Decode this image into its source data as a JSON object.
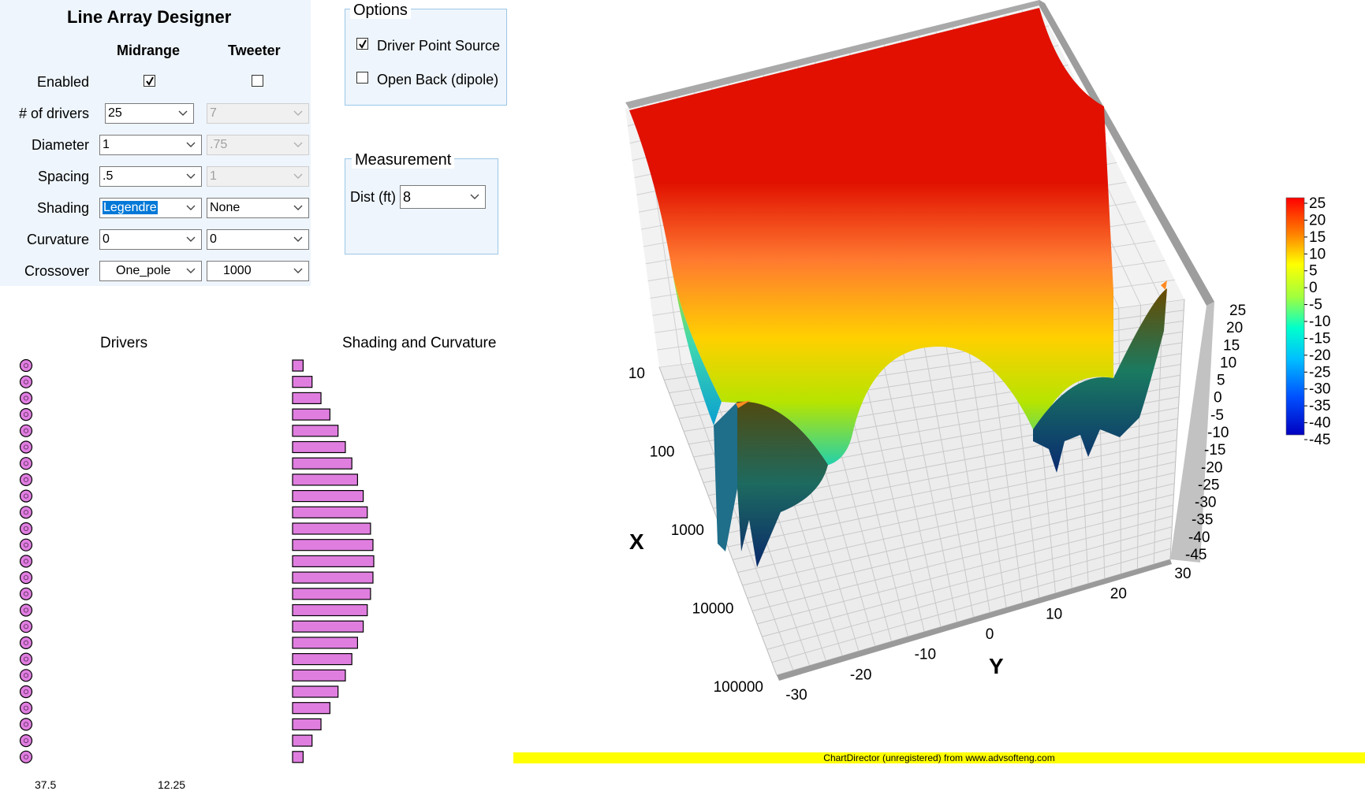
{
  "designer": {
    "title": "Line Array Designer",
    "columns": {
      "midrange": "Midrange",
      "tweeter": "Tweeter"
    },
    "rows": [
      {
        "label": "Enabled",
        "midrange": {
          "type": "checkbox",
          "checked": true
        },
        "tweeter": {
          "type": "checkbox",
          "checked": false
        }
      },
      {
        "label": "# of drivers",
        "midrange": {
          "type": "combo",
          "value": "25",
          "enabled": true
        },
        "tweeter": {
          "type": "combo",
          "value": "7",
          "enabled": false
        }
      },
      {
        "label": "Diameter",
        "midrange": {
          "type": "combo",
          "value": "1",
          "enabled": true
        },
        "tweeter": {
          "type": "combo",
          "value": ".75",
          "enabled": false
        }
      },
      {
        "label": "Spacing",
        "midrange": {
          "type": "combo",
          "value": ".5",
          "enabled": true
        },
        "tweeter": {
          "type": "combo",
          "value": "1",
          "enabled": false
        }
      },
      {
        "label": "Shading",
        "midrange": {
          "type": "combo",
          "value": "Legendre",
          "enabled": true,
          "selected": true
        },
        "tweeter": {
          "type": "combo",
          "value": "None",
          "enabled": true
        }
      },
      {
        "label": "Curvature",
        "midrange": {
          "type": "combo",
          "value": "0",
          "enabled": true
        },
        "tweeter": {
          "type": "combo",
          "value": "0",
          "enabled": true
        }
      },
      {
        "label": "Crossover",
        "midrange": {
          "type": "combo",
          "value": "One_pole",
          "enabled": true
        },
        "tweeter": {
          "type": "combo",
          "value": "1000",
          "enabled": true
        }
      }
    ]
  },
  "options": {
    "title": "Options",
    "driver_point_source": {
      "label": "Driver Point Source",
      "checked": true
    },
    "open_back": {
      "label": "Open Back (dipole)",
      "checked": false
    }
  },
  "measurement": {
    "title": "Measurement",
    "dist_label": "Dist (ft)",
    "dist_value": "8"
  },
  "drivers_panel": {
    "title": "Drivers",
    "count": 25,
    "axis_left": "37.5",
    "axis_right": "12.25",
    "color": "#e07ee0"
  },
  "shading_panel": {
    "title": "Shading and Curvature",
    "bar_color": "#e07ee0",
    "weights": [
      0.13,
      0.24,
      0.35,
      0.46,
      0.56,
      0.65,
      0.73,
      0.8,
      0.87,
      0.92,
      0.96,
      0.99,
      1.0,
      0.99,
      0.96,
      0.92,
      0.87,
      0.8,
      0.73,
      0.65,
      0.56,
      0.46,
      0.35,
      0.24,
      0.13
    ]
  },
  "chart_data": {
    "type": "surface",
    "xlabel": "X",
    "ylabel": "Y",
    "x_ticks": [
      "10",
      "100",
      "1000",
      "10000",
      "100000"
    ],
    "x_scale": "log",
    "x_range": [
      10,
      100000
    ],
    "y_ticks": [
      "-30",
      "-20",
      "-10",
      "0",
      "10",
      "20",
      "30"
    ],
    "y_range": [
      -30,
      30
    ],
    "z_ticks": [
      "25",
      "20",
      "15",
      "10",
      "5",
      "0",
      "-5",
      "-10",
      "-15",
      "-20",
      "-25",
      "-30",
      "-35",
      "-40",
      "-45"
    ],
    "z_range": [
      -45,
      25
    ],
    "colorbar_ticks": [
      "25",
      "20",
      "15",
      "10",
      "5",
      "0",
      "-5",
      "-10",
      "-15",
      "-20",
      "-25",
      "-30",
      "-35",
      "-40",
      "-45"
    ],
    "colorbar_range": [
      -45,
      25
    ],
    "colorbar_colors": [
      "#ff0000",
      "#ff7f00",
      "#ffff00",
      "#9fff3f",
      "#00ffcc",
      "#00bfff",
      "#0050ff",
      "#0000c0"
    ]
  },
  "watermark": "ChartDirector (unregistered) from www.advsofteng.com"
}
